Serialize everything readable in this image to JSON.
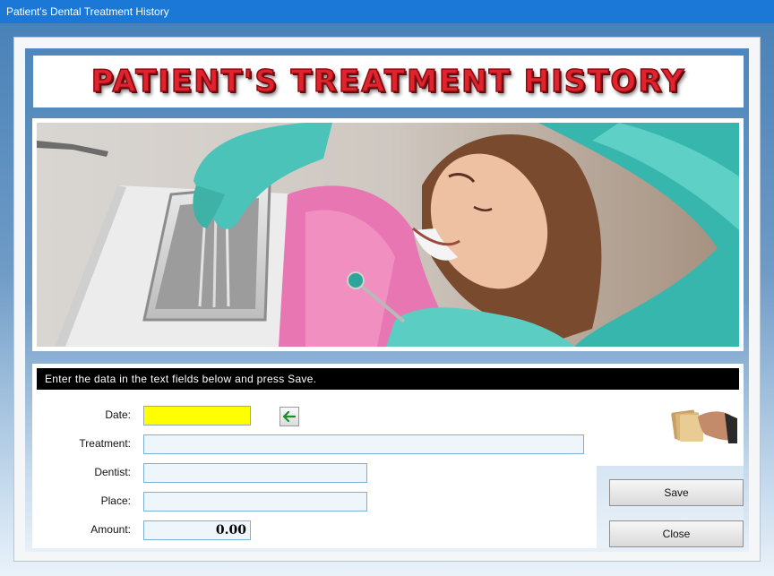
{
  "window": {
    "title": "Patient's Dental Treatment History"
  },
  "banner": {
    "title": "PATIENT'S TREATMENT HISTORY"
  },
  "instruction": "Enter the data in the text fields below and press Save.",
  "form": {
    "date": {
      "label": "Date:",
      "value": ""
    },
    "treatment": {
      "label": "Treatment:",
      "value": ""
    },
    "dentist": {
      "label": "Dentist:",
      "value": ""
    },
    "place": {
      "label": "Place:",
      "value": ""
    },
    "amount": {
      "label": "Amount:",
      "value": "0.00"
    }
  },
  "icons": {
    "today": "green-left-arrow-icon",
    "money": "hand-with-banknotes-icon"
  },
  "buttons": {
    "save": "Save",
    "close": "Close"
  },
  "colors": {
    "titlebar": "#1b78d6",
    "banner_text": "#e0242d",
    "date_highlight": "#ffff00",
    "instruction_bar": "#000000"
  }
}
